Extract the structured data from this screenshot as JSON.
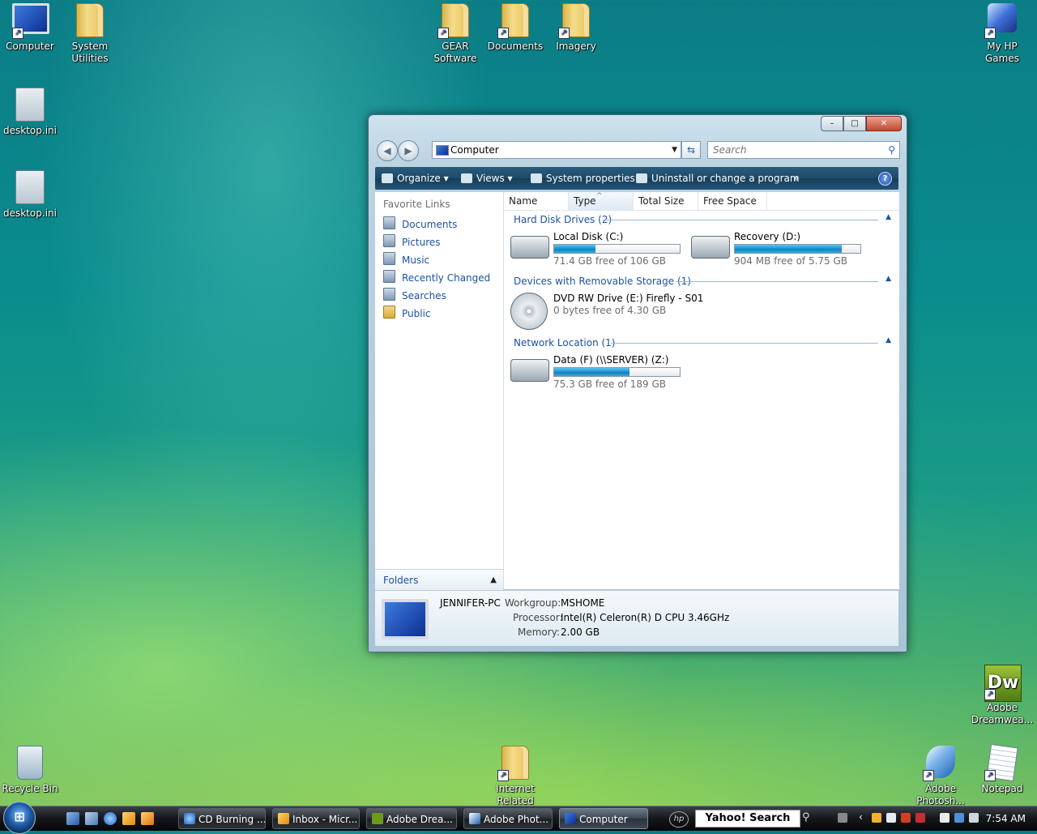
{
  "desktop": {
    "icons": [
      {
        "label": "Computer"
      },
      {
        "label": "System Utilities"
      },
      {
        "label": "desktop.ini"
      },
      {
        "label": "desktop.ini"
      },
      {
        "label": "GEAR Software"
      },
      {
        "label": "Documents"
      },
      {
        "label": "Imagery"
      },
      {
        "label": "My HP Games"
      },
      {
        "label": "Adobe Dreamwea..."
      },
      {
        "label": "Recycle Bin"
      },
      {
        "label": "Internet Related"
      },
      {
        "label": "Adobe Photosh..."
      },
      {
        "label": "Notepad"
      }
    ]
  },
  "window": {
    "caption_buttons": {
      "minimize": "–",
      "maximize": "□",
      "close": "✕"
    },
    "nav": {
      "back": "◀",
      "forward": "▶",
      "address": "Computer",
      "search_placeholder": "Search"
    },
    "toolbar": {
      "organize": "Organize",
      "views": "Views",
      "system_properties": "System properties",
      "uninstall": "Uninstall or change a program",
      "more": "»",
      "help": "?"
    },
    "favorite_links": {
      "title": "Favorite Links",
      "items": [
        "Documents",
        "Pictures",
        "Music",
        "Recently Changed",
        "Searches",
        "Public"
      ]
    },
    "folders_label": "Folders",
    "columns": [
      "Name",
      "Type",
      "Total Size",
      "Free Space"
    ],
    "groups": [
      {
        "title": "Hard Disk Drives (2)",
        "items": [
          {
            "name": "Local Disk (C:)",
            "free": "71.4 GB free of 106 GB",
            "used_fraction": 0.33
          },
          {
            "name": "Recovery (D:)",
            "free": "904 MB free of 5.75 GB",
            "used_fraction": 0.85
          }
        ]
      },
      {
        "title": "Devices with Removable Storage (1)",
        "items": [
          {
            "name": "DVD RW Drive (E:) Firefly - S01",
            "free": "0 bytes free of 4.30 GB"
          }
        ]
      },
      {
        "title": "Network Location (1)",
        "items": [
          {
            "name": "Data (F) (\\\\SERVER) (Z:)",
            "free": "75.3 GB free of 189 GB",
            "used_fraction": 0.6
          }
        ]
      }
    ],
    "details": {
      "pc_name": "JENNIFER-PC",
      "workgroup_label": "Workgroup:",
      "workgroup": "MSHOME",
      "processor_label": "Processor:",
      "processor": "Intel(R) Celeron(R) D CPU 3.46GHz",
      "memory_label": "Memory:",
      "memory": "2.00 GB"
    }
  },
  "taskbar": {
    "tasks": [
      "CD Burning ...",
      "Inbox - Micr...",
      "Adobe Drea...",
      "Adobe Phot...",
      "Computer"
    ],
    "yahoo_search": "Yahoo! Search",
    "clock": "7:54 AM"
  }
}
